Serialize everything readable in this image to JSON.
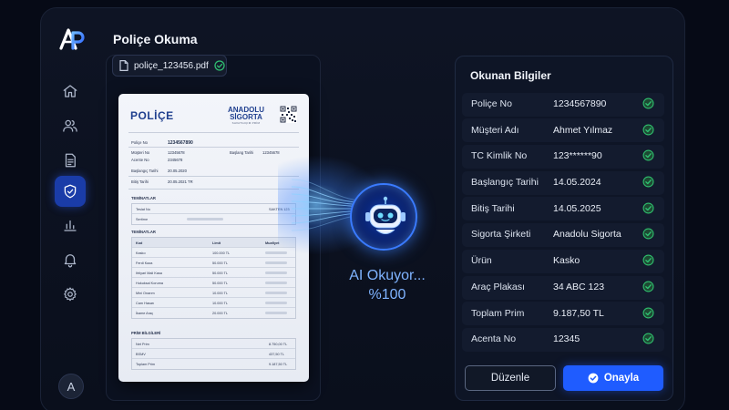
{
  "app": {
    "logo_text": "AP"
  },
  "sidebar": {
    "items": [
      {
        "id": "home",
        "icon": "home-icon"
      },
      {
        "id": "users",
        "icon": "users-icon"
      },
      {
        "id": "documents",
        "icon": "document-icon"
      },
      {
        "id": "security",
        "icon": "shield-check-icon",
        "active": true
      },
      {
        "id": "reports",
        "icon": "bar-chart-icon"
      },
      {
        "id": "notifications",
        "icon": "bell-icon"
      },
      {
        "id": "settings",
        "icon": "gear-icon"
      }
    ],
    "avatar_initial": "A"
  },
  "main": {
    "title": "Poliçe Okuma",
    "file_name": "poliçe_123456.pdf"
  },
  "document": {
    "title": "POLİÇE",
    "brand_line1": "ANADOLU",
    "brand_line2": "SİGORTA",
    "brand_tagline": "SAVATGIÇIM PRİM",
    "fields": [
      {
        "label": "Poliçe No",
        "value": "1234567890"
      },
      {
        "label": "Müşteri No",
        "value": "12345678"
      },
      {
        "label": "Acente No",
        "value": "2345678"
      },
      {
        "label": "Başlangıç Tarihi",
        "value": "20.05.2020"
      },
      {
        "label": "Bitiş Tarihi",
        "value": "20.05.2021 TR"
      }
    ],
    "right_fields": [
      {
        "label": "Başlang Tarihi",
        "value": "12345678"
      }
    ],
    "section1": "TEMİNATLAR",
    "section1_rows": [
      {
        "label": "Teslat No",
        "value": "SAKTEN 123"
      },
      {
        "label": "Sertime"
      }
    ],
    "section2": "TEMİNATLAR",
    "section2_head": [
      "Kod",
      "Limit",
      "Muafiyet"
    ],
    "section2_rows": [
      {
        "label": "Kasko",
        "limit": "100.000 TL"
      },
      {
        "label": "Ferdi Kaza",
        "limit": "50.000 TL"
      },
      {
        "label": "Ihtiyari Mali Kasa",
        "limit": "50.000 TL"
      },
      {
        "label": "Hukuksal Koruma",
        "limit": "50.000 TL"
      },
      {
        "label": "Mini Onarım",
        "limit": "10.000 TL"
      },
      {
        "label": "Cam Hasarı",
        "limit": "10.000 TL"
      },
      {
        "label": "İkame Araç",
        "limit": "20.000 TL"
      }
    ],
    "section3": "PRİM BİLGİLERİ",
    "section3_rows": [
      {
        "label": "Net Prim",
        "value": "8.750,00 TL"
      },
      {
        "label": "BSMV",
        "value": "437,50 TL"
      },
      {
        "label": "Toplam Prim",
        "value": "9.187,50 TL"
      }
    ]
  },
  "ai": {
    "label": "AI Okuyor...",
    "percent": "%100"
  },
  "info_panel": {
    "title": "Okunan Bilgiler",
    "rows": [
      {
        "key": "Poliçe No",
        "value": "1234567890"
      },
      {
        "key": "Müşteri Adı",
        "value": "Ahmet Yılmaz"
      },
      {
        "key": "TC Kimlik No",
        "value": "123******90"
      },
      {
        "key": "Başlangıç Tarihi",
        "value": "14.05.2024"
      },
      {
        "key": "Bitiş Tarihi",
        "value": "14.05.2025"
      },
      {
        "key": "Sigorta Şirketi",
        "value": "Anadolu Sigorta"
      },
      {
        "key": "Ürün",
        "value": "Kasko"
      },
      {
        "key": "Araç Plakası",
        "value": "34 ABC 123"
      },
      {
        "key": "Toplam Prim",
        "value": "9.187,50 TL"
      },
      {
        "key": "Acenta No",
        "value": "12345"
      }
    ]
  },
  "actions": {
    "edit_label": "Düzenle",
    "approve_label": "Onayla"
  },
  "colors": {
    "accent": "#1f5cff",
    "success": "#2fbf71",
    "background": "#060a16",
    "highlight": "#7fb3ff"
  }
}
